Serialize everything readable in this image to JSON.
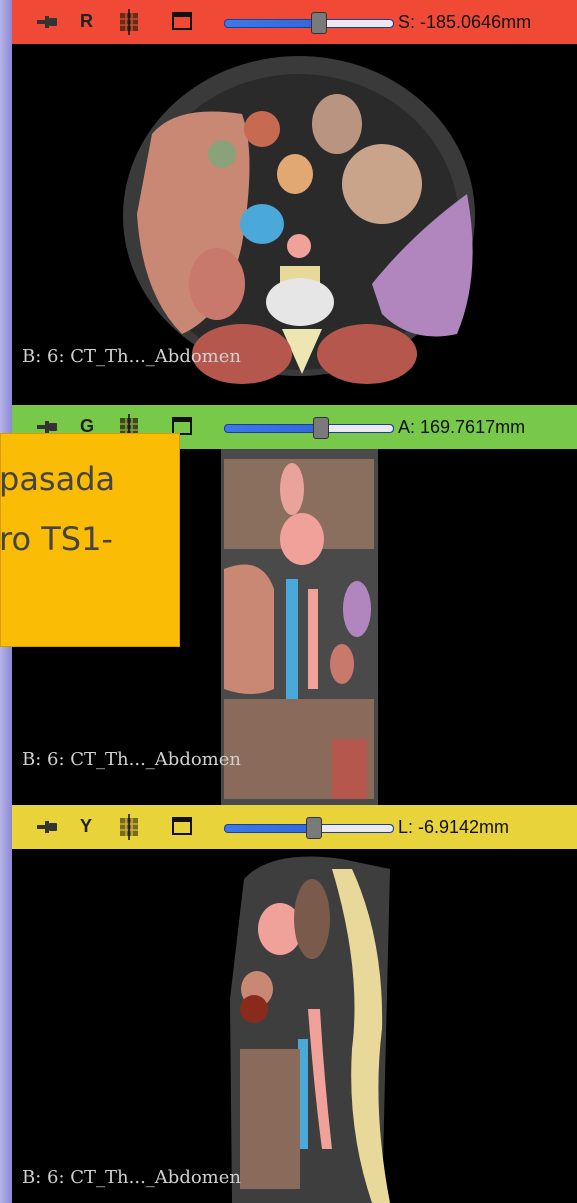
{
  "views": {
    "red": {
      "letter": "R",
      "readout": "S: -185.0646mm",
      "slice_position": 0.56,
      "label": "B: 6: CT_Th..._Abdomen"
    },
    "green": {
      "letter": "G",
      "readout": "A: 169.7617mm",
      "slice_position": 0.57,
      "label": "B: 6: CT_Th..._Abdomen"
    },
    "yellow": {
      "letter": "Y",
      "readout": "L: -6.9142mm",
      "slice_position": 0.53,
      "label": "B: 6: CT_Th..._Abdomen"
    }
  },
  "callout": {
    "line1": "pasada",
    "line2": "ro TS1-"
  },
  "colors": {
    "red_bar": "#f04a37",
    "green_bar": "#78c84a",
    "yellow_bar": "#e8d43a",
    "callout_bg": "#fbbc05",
    "slider_fill": "#3c79e8"
  },
  "icons": {
    "pin": "pin-icon",
    "controls": "slice-controls-icon",
    "window": "maximize-view-icon"
  }
}
